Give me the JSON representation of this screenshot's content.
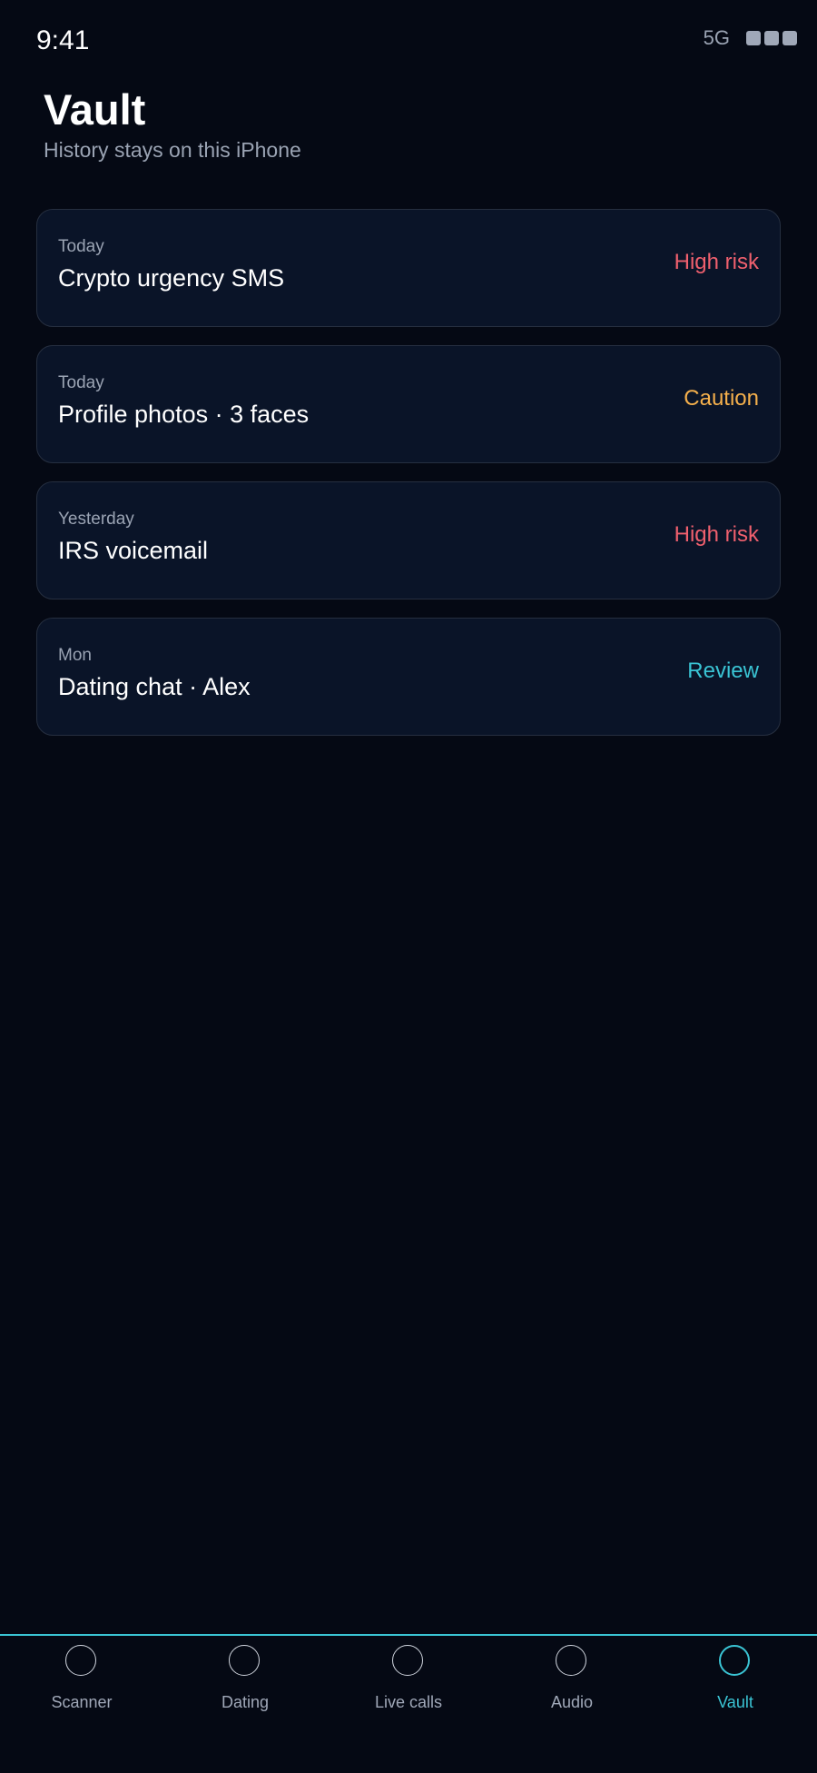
{
  "status_bar": {
    "time": "9:41",
    "network": "5G",
    "battery_icon": "battery-icon"
  },
  "header": {
    "title": "Vault",
    "subtitle": "History stays on this iPhone"
  },
  "colors": {
    "high_risk": "#f0606e",
    "caution": "#f5b04c",
    "review": "#3ac4d4",
    "accent": "#3ac4d4"
  },
  "items": [
    {
      "date": "Today",
      "title": "Crypto urgency SMS",
      "status": "High risk",
      "status_color": "#f0606e"
    },
    {
      "date": "Today",
      "title": "Profile photos · 3 faces",
      "status": "Caution",
      "status_color": "#f5b04c"
    },
    {
      "date": "Yesterday",
      "title": "IRS voicemail",
      "status": "High risk",
      "status_color": "#f0606e"
    },
    {
      "date": "Mon",
      "title": "Dating chat · Alex",
      "status": "Review",
      "status_color": "#3ac4d4"
    }
  ],
  "tabs": [
    {
      "label": "Scanner",
      "icon": "scanner-icon",
      "active": false
    },
    {
      "label": "Dating",
      "icon": "dating-icon",
      "active": false
    },
    {
      "label": "Live calls",
      "icon": "live-calls-icon",
      "active": false
    },
    {
      "label": "Audio",
      "icon": "audio-icon",
      "active": false
    },
    {
      "label": "Vault",
      "icon": "vault-icon",
      "active": true
    }
  ]
}
